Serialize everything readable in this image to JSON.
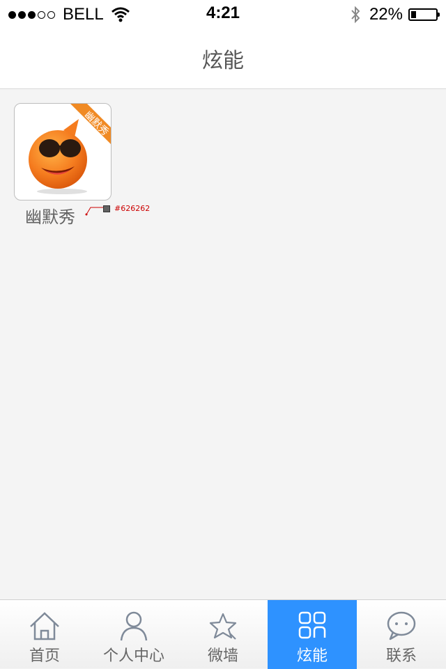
{
  "status_bar": {
    "carrier": "BELL",
    "time": "4:21",
    "battery_percent": "22%",
    "battery_level": 0.22,
    "signal_bars_filled": 3,
    "signal_bars_total": 5
  },
  "nav": {
    "title": "炫能"
  },
  "apps": [
    {
      "label": "幽默秀",
      "ribbon": "幽默秀",
      "icon": "smiley-orange-sunglasses-icon"
    }
  ],
  "annotation": {
    "color_code": "#626262"
  },
  "tabbar": {
    "active_index": 3,
    "active_color": "#2e92ff",
    "items": [
      {
        "label": "首页",
        "icon": "home-icon"
      },
      {
        "label": "个人中心",
        "icon": "person-icon"
      },
      {
        "label": "微墙",
        "icon": "star-icon"
      },
      {
        "label": "炫能",
        "icon": "grid-icon"
      },
      {
        "label": "联系",
        "icon": "chat-bubble-icon"
      }
    ]
  }
}
